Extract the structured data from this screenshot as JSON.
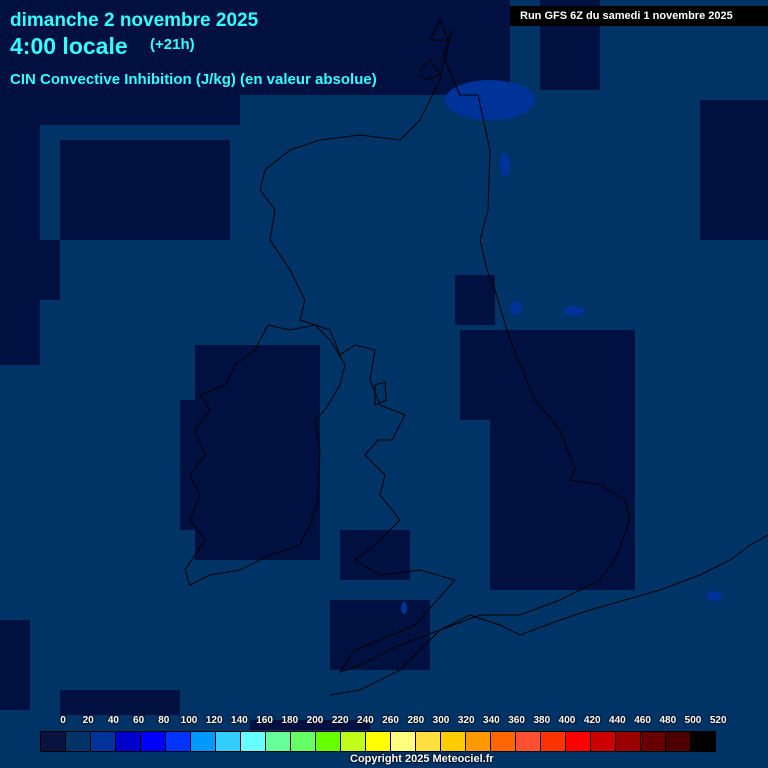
{
  "header": {
    "date": "dimanche 2 novembre 2025",
    "local_time": "4:00 locale",
    "lead_time": "(+21h)",
    "parameter": "CIN Convective Inhibition (J/kg) (en valeur absolue)",
    "run": "Run GFS 6Z du samedi 1 novembre 2025"
  },
  "legend": {
    "labels": [
      "0",
      "20",
      "40",
      "60",
      "80",
      "100",
      "120",
      "140",
      "160",
      "180",
      "200",
      "220",
      "240",
      "260",
      "280",
      "300",
      "320",
      "340",
      "360",
      "380",
      "400",
      "420",
      "440",
      "460",
      "480",
      "500",
      "520"
    ],
    "colors": [
      "#0a1240",
      "#003366",
      "#003399",
      "#0000cc",
      "#0000ff",
      "#0033ff",
      "#0099ff",
      "#33ccff",
      "#66ffff",
      "#66ff99",
      "#66ff66",
      "#66ff00",
      "#c0ff19",
      "#ffff00",
      "#ffff80",
      "#ffe040",
      "#ffcc00",
      "#ff9900",
      "#ff6600",
      "#ff5033",
      "#ff3300",
      "#ff0000",
      "#cc0000",
      "#990000",
      "#660000",
      "#4d0000",
      "#000000"
    ]
  },
  "footer": {
    "copyright": "Copyright 2025 Meteociel.fr"
  },
  "colors": {
    "base": "#003366",
    "low": "#001040",
    "blob": "#003399",
    "coast": "#000000"
  }
}
